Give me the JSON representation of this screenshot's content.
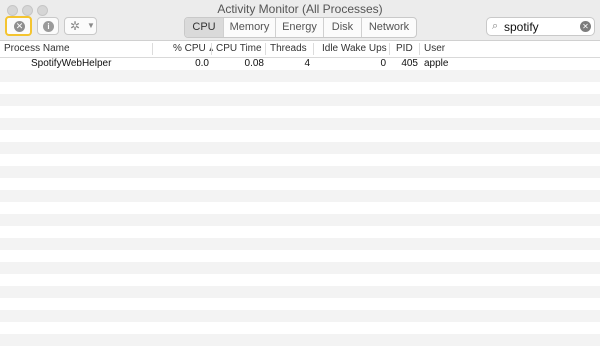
{
  "window": {
    "title": "Activity Monitor (All Processes)"
  },
  "toolbar": {
    "stop_button_icon": "stop-process-icon",
    "info_button_icon": "info-icon",
    "action_menu_icon": "gear-icon",
    "tabs": [
      {
        "label": "CPU",
        "active": true
      },
      {
        "label": "Memory",
        "active": false
      },
      {
        "label": "Energy",
        "active": false
      },
      {
        "label": "Disk",
        "active": false
      },
      {
        "label": "Network",
        "active": false
      }
    ],
    "search": {
      "value": "spotify"
    }
  },
  "table": {
    "columns": [
      "Process Name",
      "% CPU",
      "CPU Time",
      "Threads",
      "Idle Wake Ups",
      "PID",
      "User"
    ],
    "sort_column": "% CPU",
    "rows": [
      {
        "name": "SpotifyWebHelper",
        "cpu": "0.0",
        "cpu_time": "0.08",
        "threads": "4",
        "idle_wake_ups": "0",
        "pid": "405",
        "user": "apple"
      }
    ]
  },
  "colors": {
    "highlight": "#f4c430",
    "row_alt": "#f3f3f3",
    "toolbar_bg": "#ececec"
  }
}
